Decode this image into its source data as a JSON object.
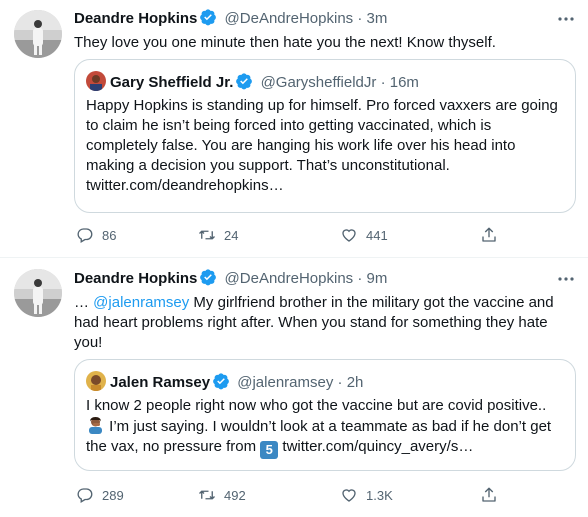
{
  "tweets": [
    {
      "author_name": "Deandre Hopkins",
      "handle": "@DeAndreHopkins",
      "separator": "·",
      "time": "3m",
      "text": "They love you one minute then hate you the next! Know thyself.",
      "quote": {
        "author_name": "Gary Sheffield Jr.",
        "handle": "@GarysheffieldJr",
        "separator": "·",
        "time": "16m",
        "text": "Happy Hopkins is standing up for himself. Pro forced vaxxers are going to claim he isn’t being forced into getting vaccinated, which is completely false. You are hanging his work life over his head into making a decision you support. That’s unconstitutional. twitter.com/deandrehopkins…"
      },
      "counts": {
        "replies": "86",
        "retweets": "24",
        "likes": "441"
      }
    },
    {
      "author_name": "Deandre Hopkins",
      "handle": "@DeAndreHopkins",
      "separator": "·",
      "time": "9m",
      "text_prefix": "… ",
      "mention": "@jalenramsey",
      "text": " My girlfriend brother in the military got the vaccine and had heart problems right after. When you stand for something they hate you!",
      "quote": {
        "author_name": "Jalen Ramsey",
        "handle": "@jalenramsey",
        "separator": "·",
        "time": "2h",
        "text_line1": "I know 2 people right now who got the vaccine but are covid positive..",
        "text_part2": " I’m just saying. I wouldn’t look at a teammate as bad if he don’t get the vax, no pressure from ",
        "keycap": "5",
        "text_part3": " twitter.com/quincy_avery/s…"
      },
      "counts": {
        "replies": "289",
        "retweets": "492",
        "likes": "1.3K"
      }
    }
  ],
  "colors": {
    "text": "#0f1419",
    "secondary": "#536471",
    "accent": "#1d9bf0",
    "border": "#cfd9de",
    "divider": "#eff3f4"
  },
  "icons": [
    "verified-badge-icon",
    "more-options-icon",
    "reply-icon",
    "retweet-icon",
    "like-icon",
    "share-icon",
    "man-facepalming-emoji",
    "keycap-5-emoji"
  ]
}
